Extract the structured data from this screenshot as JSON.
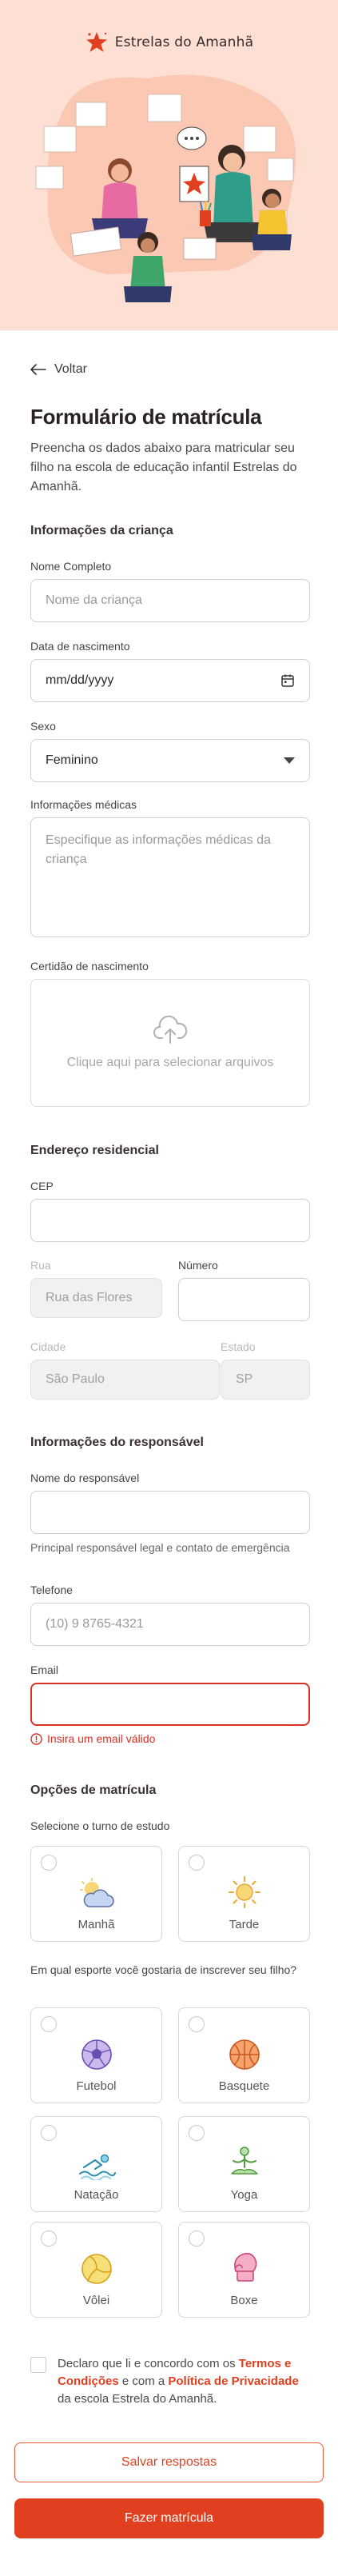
{
  "brand": {
    "name": "Estrelas do Amanhã"
  },
  "nav": {
    "back_label": "Voltar"
  },
  "page": {
    "title": "Formulário de matrícula",
    "subtitle": "Preencha os dados abaixo para matricular seu filho na escola de educação infantil Estrelas do Amanhã."
  },
  "child": {
    "section_title": "Informações da criança",
    "name_label": "Nome Completo",
    "name_placeholder": "Nome da criança",
    "birth_label": "Data de nascimento",
    "birth_placeholder": "mm/dd/yyyy",
    "sex_label": "Sexo",
    "sex_value": "Feminino",
    "medical_label": "Informações médicas",
    "medical_placeholder": "Especifique as informações médicas da criança",
    "certificate_label": "Certidão de nascimento",
    "upload_text": "Clique aqui para selecionar arquivos"
  },
  "address": {
    "section_title": "Endereço residencial",
    "cep_label": "CEP",
    "cep_value": "",
    "street_label": "Rua",
    "street_value": "Rua das Flores",
    "number_label": "Número",
    "number_value": "",
    "city_label": "Cidade",
    "city_value": "São Paulo",
    "state_label": "Estado",
    "state_value": "SP"
  },
  "guardian": {
    "section_title": "Informações do responsável",
    "name_label": "Nome do responsável",
    "name_value": "",
    "name_helper": "Principal responsável legal e contato de emergência",
    "phone_label": "Telefone",
    "phone_placeholder": "(10) 9 8765-4321",
    "email_label": "Email",
    "email_value": "",
    "email_error": "Insira um email válido"
  },
  "options": {
    "section_title": "Opções de matrícula",
    "shift_question": "Selecione o turno de estudo",
    "shifts": [
      {
        "label": "Manhã",
        "icon": "cloud-sun-icon"
      },
      {
        "label": "Tarde",
        "icon": "sun-icon"
      }
    ],
    "sport_question": "Em qual esporte você gostaria de inscrever seu filho?",
    "sports": [
      {
        "label": "Futebol",
        "icon": "soccer-ball-icon"
      },
      {
        "label": "Basquete",
        "icon": "basketball-icon"
      },
      {
        "label": "Natação",
        "icon": "swimmer-icon"
      },
      {
        "label": "Yoga",
        "icon": "yoga-icon"
      },
      {
        "label": "Vôlei",
        "icon": "volleyball-icon"
      },
      {
        "label": "Boxe",
        "icon": "boxing-glove-icon"
      }
    ]
  },
  "agreement": {
    "prefix": "Declaro que li e concordo com os ",
    "terms": "Termos e Condições",
    "middle": " e com a ",
    "privacy": "Política de Privacidade",
    "suffix": " da escola Estrela do Amanhã."
  },
  "actions": {
    "save_label": "Salvar respostas",
    "submit_label": "Fazer matrícula"
  },
  "colors": {
    "hero_bg": "#fde0d3",
    "accent": "#e0401f",
    "error": "#d93025"
  }
}
